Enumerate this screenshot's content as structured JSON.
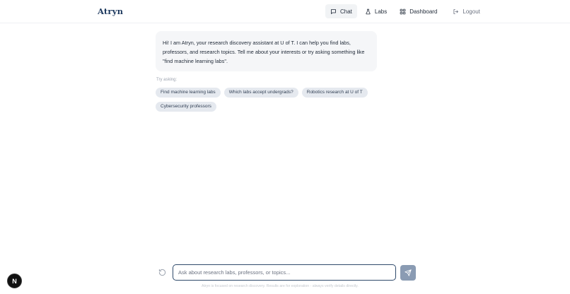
{
  "app": {
    "brand": "Atryn"
  },
  "nav": {
    "items": [
      {
        "label": "Chat",
        "icon": "chat-icon",
        "active": true
      },
      {
        "label": "Labs",
        "icon": "flask-icon",
        "active": false
      },
      {
        "label": "Dashboard",
        "icon": "grid-icon",
        "active": false
      },
      {
        "label": "Logout",
        "icon": "logout-icon",
        "active": false
      }
    ]
  },
  "chat": {
    "messages": [
      {
        "role": "assistant",
        "text": "Hi! I am Atryn, your research discovery assistant at U of T. I can help you find labs, professors, and research topics. Tell me about your interests or try asking something like \"find machine learning labs\"."
      }
    ],
    "suggestions_label": "Try asking:",
    "suggestions": [
      "Find machine learning labs",
      "Which labs accept undergrads?",
      "Robotics research at U of T",
      "Cybersecurity professors"
    ]
  },
  "composer": {
    "placeholder": "Ask about research labs, professors, or topics...",
    "value": ""
  },
  "footer": {
    "disclaimer": "Atryn is focused on research discovery. Results are for exploration - always verify details directly."
  },
  "devtools": {
    "badge": "N"
  },
  "colors": {
    "brand": "#1e3a5f",
    "send_button": "#8a9bb3",
    "chip_bg": "#e5e9ef",
    "bubble_bg": "#f5f6f8"
  }
}
